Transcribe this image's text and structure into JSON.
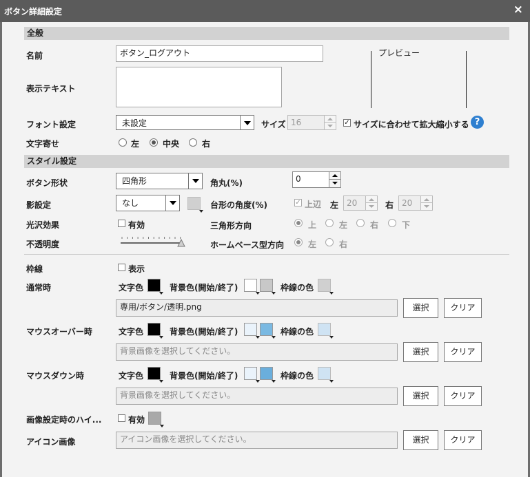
{
  "window": {
    "title": "ボタン詳細設定",
    "close_glyph": "×"
  },
  "sections": {
    "general": "全般",
    "style": "スタイル設定"
  },
  "labels": {
    "name": "名前",
    "display_text": "表示テキスト",
    "font_settings": "フォント設定",
    "text_align": "文字寄せ",
    "button_shape": "ボタン形状",
    "shadow": "影設定",
    "gloss": "光沢効果",
    "opacity": "不透明度",
    "border": "枠線",
    "normal": "通常時",
    "mouseover": "マウスオーバー時",
    "mousedown": "マウスダウン時",
    "image_highlight": "画像設定時のハイ...",
    "icon_image": "アイコン画像"
  },
  "preview_label": "プレビュー",
  "fields": {
    "name_value": "ボタン_ログアウト",
    "display_text_value": "",
    "font_select": "未設定",
    "size_label": "サイズ",
    "size_value": "16",
    "fit_checkbox": {
      "label": "サイズに合わせて拡大縮小する",
      "checked": true
    },
    "help_glyph": "?"
  },
  "text_align_options": [
    "左",
    "中央",
    "右"
  ],
  "text_align_selected": "中央",
  "shape": {
    "select": "四角形",
    "corner_label": "角丸(%)",
    "corner_value": "0"
  },
  "shadow": {
    "select": "なし",
    "trapezoid_label": "台形の角度(%)",
    "top_edge": {
      "label": "上辺",
      "checked": true
    },
    "left_label": "左",
    "left_value": "20",
    "right_label": "右",
    "right_value": "20"
  },
  "gloss": {
    "checkbox_label": "有効",
    "triangle_label": "三角形方向",
    "triangle_options": [
      "上",
      "左",
      "右",
      "下"
    ],
    "triangle_selected": "上"
  },
  "opacity": {
    "level": 1.0,
    "homebase_label": "ホームベース型方向",
    "homebase_options": [
      "左",
      "右"
    ],
    "homebase_selected": "左"
  },
  "border": {
    "checkbox_label": "表示"
  },
  "color_labels": {
    "text": "文字色",
    "bg": "背景色(開始/終了)",
    "border": "枠線の色"
  },
  "states": {
    "normal": {
      "text_color": "#000000",
      "bg_start": "#ffffff",
      "bg_end": "#c8c8c8",
      "border_color": "#d0d0d0",
      "image_path": "専用/ボタン/透明.png"
    },
    "mouseover": {
      "text_color": "#000000",
      "bg_start": "#eaf3fb",
      "bg_end": "#7ab9e2",
      "border_color": "#cfe3f3",
      "image_placeholder": "背景画像を選択してください。"
    },
    "mousedown": {
      "text_color": "#000000",
      "bg_start": "#eaf3fb",
      "bg_end": "#6aaedc",
      "border_color": "#cfe3f3",
      "image_placeholder": "背景画像を選択してください。"
    }
  },
  "highlight": {
    "checkbox_label": "有効",
    "color": "#a9a9a9"
  },
  "icon": {
    "placeholder": "アイコン画像を選択してください。"
  },
  "buttons": {
    "select": "選択",
    "clear": "クリア"
  }
}
